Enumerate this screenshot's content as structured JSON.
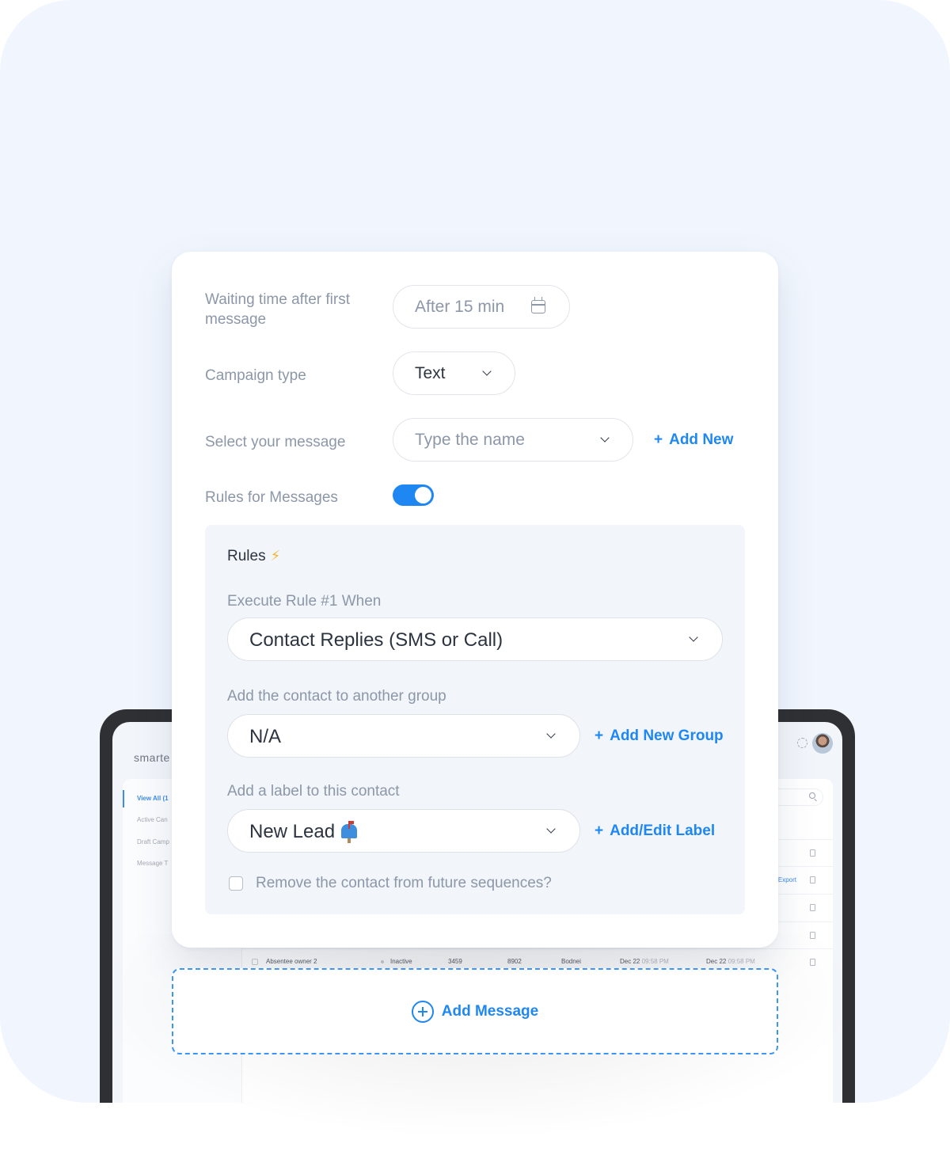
{
  "background_app": {
    "logo": "smarte",
    "sidebar": {
      "items": [
        {
          "label": "View All (1",
          "active": true
        },
        {
          "label": "Active Can",
          "active": false
        },
        {
          "label": "Draft Camp",
          "active": false
        },
        {
          "label": "Message T",
          "active": false
        }
      ]
    },
    "rows": [
      {
        "name": "",
        "status": "",
        "c1": "",
        "c2": "",
        "owner": "",
        "date1": "",
        "time1": "",
        "date2": "",
        "time2": "",
        "export": ""
      },
      {
        "name": "",
        "status": "",
        "c1": "",
        "c2": "",
        "owner": "",
        "date1": "",
        "time1": "",
        "date2": "",
        "time2": "",
        "export": "Export"
      },
      {
        "name": "",
        "status": "",
        "c1": "",
        "c2": "",
        "owner": "",
        "date1": "",
        "time1": "",
        "date2": "",
        "time2": "",
        "export": ""
      },
      {
        "name": "",
        "status": "",
        "c1": "",
        "c2": "",
        "owner": "",
        "date1": "",
        "time1": "",
        "date2": "",
        "time2": "",
        "export": ""
      },
      {
        "name": "Absentee owner 2",
        "status": "Inactive",
        "c1": "3459",
        "c2": "8902",
        "owner": "Bodnei",
        "date1": "Dec 22",
        "time1": "09:58 PM",
        "date2": "Dec 22",
        "time2": "09:58 PM",
        "export": ""
      }
    ]
  },
  "form": {
    "waiting_time": {
      "label": "Waiting time after first message",
      "value": "After 15 min",
      "icon": "calendar-icon"
    },
    "campaign_type": {
      "label": "Campaign type",
      "value": "Text"
    },
    "select_message": {
      "label": "Select your message",
      "placeholder": "Type the name",
      "add_link": "Add New"
    },
    "rules_toggle": {
      "label": "Rules for Messages",
      "on": true
    }
  },
  "rules": {
    "title": "Rules",
    "title_icon": "⚡",
    "execute_rule": {
      "label": "Execute Rule #1 When",
      "value": "Contact Replies (SMS or Call)"
    },
    "group": {
      "label": "Add the contact to another group",
      "value": "N/A",
      "add_link": "Add New Group"
    },
    "contact_label": {
      "label": "Add a label to this contact",
      "value": "New Lead",
      "icon": "mailbox-icon",
      "add_link": "Add/Edit Label"
    },
    "remove_checkbox": {
      "label": "Remove the contact from future sequences?",
      "checked": false
    }
  },
  "add_message": {
    "label": "Add Message"
  },
  "colors": {
    "accent": "#1f87f2",
    "bolt": "#f5b731"
  }
}
